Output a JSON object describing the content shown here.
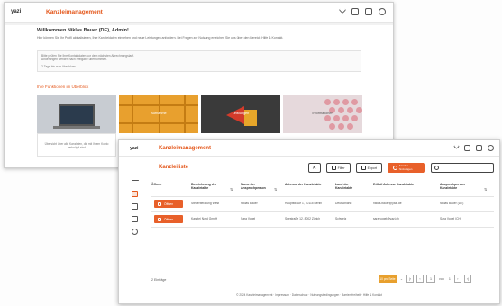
{
  "back_window": {
    "logo": "yazi",
    "title": "Kanzleimanagement",
    "welcome": "Willkommen Niklas Bauer (DE), Admin!",
    "intro": "Hier können Sie Ihr Profil aktualisieren, Ihre Kanzleidaten einsehen und neue Leistungen anfordern. Bei Fragen zur Nutzung erreichen Sie uns über den Bereich Hilfe & Kontakt.",
    "notice_line1": "Bitte prüfen Sie Ihre Kontaktdaten vor dem nächsten Abrechnungslauf.",
    "notice_line2": "Änderungen werden nach Freigabe übernommen.",
    "notice_label": "2 Tage bis zum Abschluss",
    "section": "Ihre Funktionen im Überblick",
    "tiles": [
      "",
      "Aufnahme",
      "Leistungen",
      "Informationen"
    ],
    "tile_card": "Übersicht über alle Kanzleien, die mit Ihrem Konto verknüpft sind"
  },
  "front_window": {
    "logo": "yazi",
    "title": "Kanzleimanagement",
    "page_title": "Kanzleiliste",
    "toolbar": {
      "filter_label": "Filter",
      "export_label": "Export",
      "add_label": "Kanzlei hinzufügen",
      "search_placeholder": ""
    },
    "columns": [
      "Öffnen",
      "Bezeichnung der Kanzleiakte",
      "Name der Ansprechperson",
      "Adresse der Kanzleiakte",
      "Land der Kanzleiakte",
      "E-Mail Adresse Kanzleiakte",
      "Ansprechperson Kanzleiakte"
    ],
    "rows": [
      {
        "open": "Öffnen",
        "bezeichnung": "Steuerberatung West",
        "name": "Niklas Bauer",
        "adresse": "Hauptstraße 1, 10115 Berlin",
        "land": "Deutschland",
        "email": "niklas.bauer@yazi.de",
        "kontakt": "Niklas Bauer (DE)"
      },
      {
        "open": "Öffnen",
        "bezeichnung": "Kanzlei Nord GmbH",
        "name": "Sara Vogel",
        "adresse": "Seestraße 12, 8002 Zürich",
        "land": "Schweiz",
        "email": "sara.vogel@yazi.ch",
        "kontakt": "Sara Vogel (CH)"
      }
    ],
    "row_count": "2 Einträge",
    "pager": {
      "size": "10 pro Seite",
      "current": "1",
      "of": "von",
      "total": "1"
    },
    "footer": "© 2024 Kanzleimanagement · Impressum · Datenschutz · Nutzungsbedingungen · Barrierefreiheit · Hilfe & Kontakt"
  }
}
